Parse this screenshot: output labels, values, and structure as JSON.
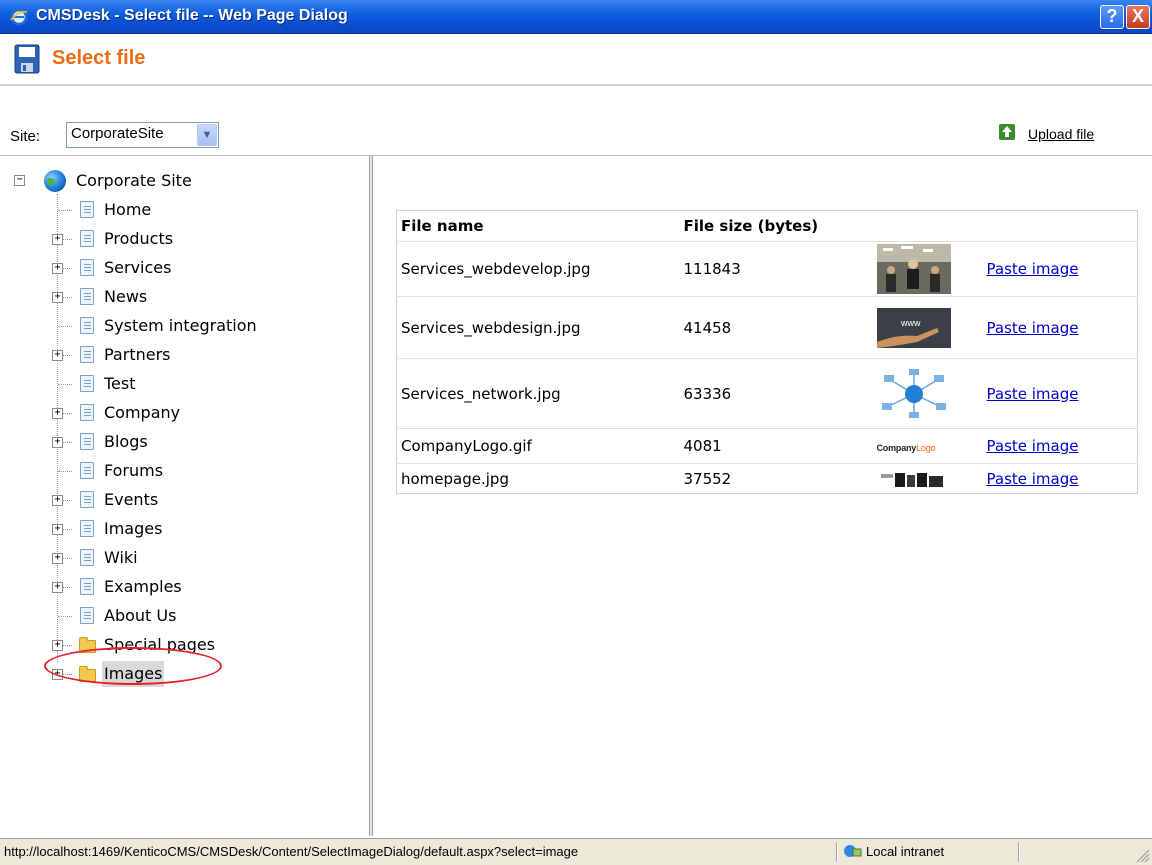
{
  "window": {
    "title": "CMSDesk - Select file -- Web Page Dialog",
    "help_glyph": "?",
    "close_glyph": "X"
  },
  "header": {
    "title": "Select file"
  },
  "site": {
    "label": "Site:",
    "selected": "CorporateSite"
  },
  "toolbar": {
    "upload_label": "Upload file"
  },
  "tree": {
    "root": "Corporate Site",
    "items": [
      {
        "label": "Home",
        "expandable": false,
        "type": "page"
      },
      {
        "label": "Products",
        "expandable": true,
        "type": "page"
      },
      {
        "label": "Services",
        "expandable": true,
        "type": "page"
      },
      {
        "label": "News",
        "expandable": true,
        "type": "page"
      },
      {
        "label": "System integration",
        "expandable": false,
        "type": "page"
      },
      {
        "label": "Partners",
        "expandable": true,
        "type": "page"
      },
      {
        "label": "Test",
        "expandable": false,
        "type": "page"
      },
      {
        "label": "Company",
        "expandable": true,
        "type": "page"
      },
      {
        "label": "Blogs",
        "expandable": true,
        "type": "page"
      },
      {
        "label": "Forums",
        "expandable": false,
        "type": "page"
      },
      {
        "label": "Events",
        "expandable": true,
        "type": "page"
      },
      {
        "label": "Images",
        "expandable": true,
        "type": "page"
      },
      {
        "label": "Wiki",
        "expandable": true,
        "type": "page"
      },
      {
        "label": "Examples",
        "expandable": true,
        "type": "page"
      },
      {
        "label": "About Us",
        "expandable": false,
        "type": "page"
      },
      {
        "label": "Special pages",
        "expandable": true,
        "type": "folder"
      },
      {
        "label": "Images",
        "expandable": true,
        "type": "folder",
        "selected": true
      }
    ]
  },
  "files": {
    "headers": [
      "File name",
      "File size (bytes)"
    ],
    "rows": [
      {
        "name": "Services_webdevelop.jpg",
        "size": "111843",
        "action": "Paste image"
      },
      {
        "name": "Services_webdesign.jpg",
        "size": "41458",
        "action": "Paste image"
      },
      {
        "name": "Services_network.jpg",
        "size": "63336",
        "action": "Paste image"
      },
      {
        "name": "CompanyLogo.gif",
        "size": "4081",
        "action": "Paste image",
        "thumb_text_a": "Company",
        "thumb_text_b": "Logo"
      },
      {
        "name": "homepage.jpg",
        "size": "37552",
        "action": "Paste image"
      }
    ],
    "thumb_www_text": "www"
  },
  "statusbar": {
    "url": "http://localhost:1469/KenticoCMS/CMSDesk/Content/SelectImageDialog/default.aspx?select=image",
    "zone": "Local intranet"
  },
  "colors": {
    "title_accent": "#f06a14",
    "link": "#0000cc",
    "highlight_ring": "#e8202a"
  }
}
